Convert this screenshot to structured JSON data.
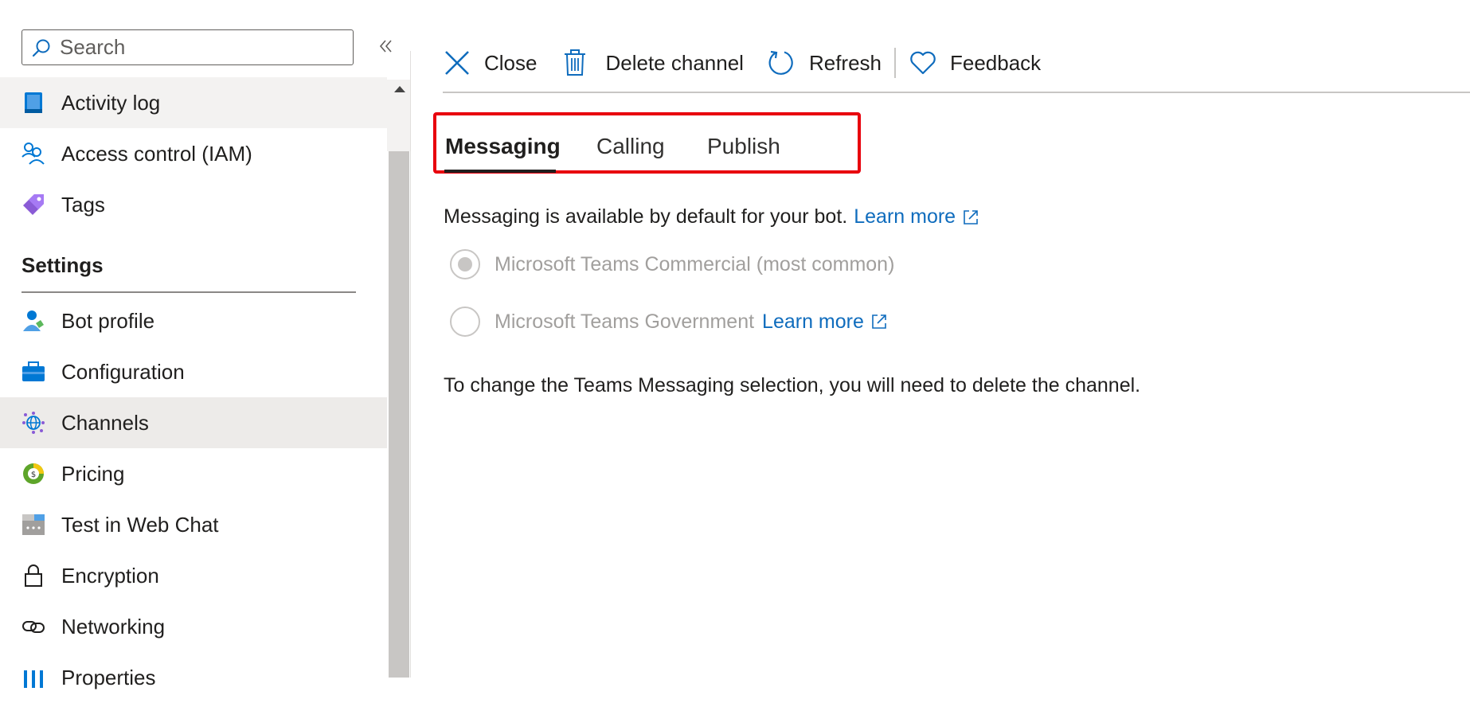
{
  "search": {
    "placeholder": "Search"
  },
  "nav": {
    "items": [
      {
        "label": "Activity log",
        "icon": "activity-log-icon"
      },
      {
        "label": "Access control (IAM)",
        "icon": "people-icon"
      },
      {
        "label": "Tags",
        "icon": "tag-icon"
      },
      {
        "label": "Bot profile",
        "icon": "bot-profile-icon"
      },
      {
        "label": "Configuration",
        "icon": "toolbox-icon"
      },
      {
        "label": "Channels",
        "icon": "globe-network-icon"
      },
      {
        "label": "Pricing",
        "icon": "pricing-icon"
      },
      {
        "label": "Test in Web Chat",
        "icon": "web-chat-icon"
      },
      {
        "label": "Encryption",
        "icon": "lock-icon"
      },
      {
        "label": "Networking",
        "icon": "link-icon"
      },
      {
        "label": "Properties",
        "icon": "properties-icon"
      }
    ],
    "section_settings": "Settings",
    "active_item": "Channels"
  },
  "toolbar": {
    "close": "Close",
    "delete": "Delete channel",
    "refresh": "Refresh",
    "feedback": "Feedback"
  },
  "tabs": [
    {
      "label": "Messaging",
      "selected": true
    },
    {
      "label": "Calling",
      "selected": false
    },
    {
      "label": "Publish",
      "selected": false
    }
  ],
  "content": {
    "info_text": "Messaging is available by default for your bot.",
    "learn_more": "Learn more",
    "options": [
      {
        "label": "Microsoft Teams Commercial (most common)",
        "selected": true,
        "disabled": true
      },
      {
        "label": "Microsoft Teams Government",
        "selected": false,
        "disabled": true
      }
    ],
    "note": "To change the Teams Messaging selection, you will need to delete the channel."
  },
  "colors": {
    "accent": "#0f6cbd",
    "highlight_box": "#e8000d"
  }
}
